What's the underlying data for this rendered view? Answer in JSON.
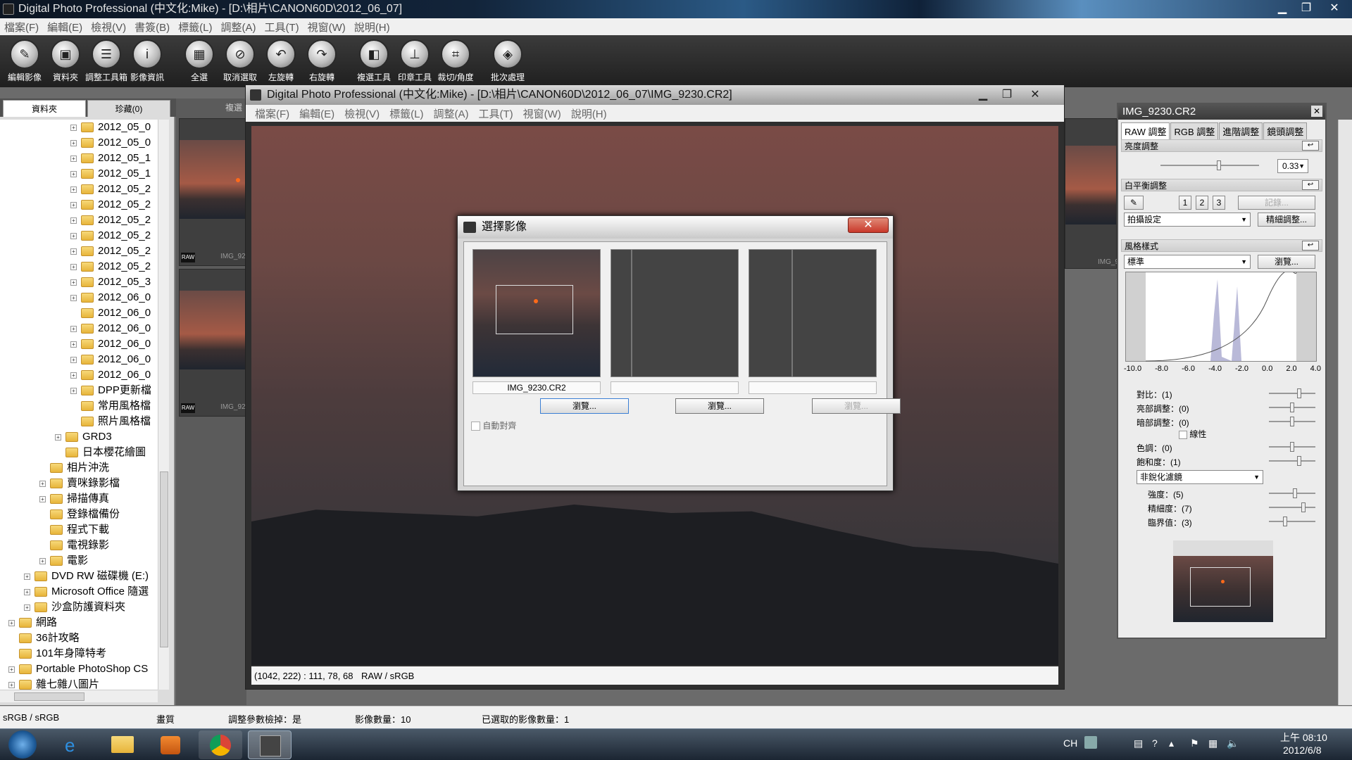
{
  "main_window": {
    "title": "Digital Photo Professional (中文化:Mike) - [D:\\相片\\CANON60D\\2012_06_07]",
    "menu": [
      "檔案(F)",
      "編輯(E)",
      "檢視(V)",
      "書簽(B)",
      "標籤(L)",
      "調整(A)",
      "工具(T)",
      "視窗(W)",
      "說明(H)"
    ]
  },
  "toolbar": {
    "buttons": [
      {
        "label": "編輯影像",
        "icon": "edit-image-icon"
      },
      {
        "label": "資料夾",
        "icon": "folder-icon"
      },
      {
        "label": "調整工具箱",
        "icon": "toolbox-icon"
      },
      {
        "label": "影像資訊",
        "icon": "info-icon"
      },
      {
        "label": "全選",
        "icon": "select-all-icon"
      },
      {
        "label": "取消選取",
        "icon": "deselect-icon"
      },
      {
        "label": "左旋轉",
        "icon": "rotate-left-icon"
      },
      {
        "label": "右旋轉",
        "icon": "rotate-right-icon"
      },
      {
        "label": "複選工具",
        "icon": "compare-tool-icon"
      },
      {
        "label": "印章工具",
        "icon": "stamp-tool-icon"
      },
      {
        "label": "裁切/角度",
        "icon": "crop-icon"
      },
      {
        "label": "批次處理",
        "icon": "batch-icon"
      }
    ]
  },
  "left_panel": {
    "tabs": [
      "資料夾",
      "珍藏(0)"
    ],
    "tree": [
      {
        "label": "2012_05_0",
        "expand": "+",
        "indent": 3
      },
      {
        "label": "2012_05_0",
        "expand": "+",
        "indent": 3
      },
      {
        "label": "2012_05_1",
        "expand": "+",
        "indent": 3
      },
      {
        "label": "2012_05_1",
        "expand": "+",
        "indent": 3
      },
      {
        "label": "2012_05_2",
        "expand": "+",
        "indent": 3
      },
      {
        "label": "2012_05_2",
        "expand": "+",
        "indent": 3
      },
      {
        "label": "2012_05_2",
        "expand": "+",
        "indent": 3
      },
      {
        "label": "2012_05_2",
        "expand": "+",
        "indent": 3
      },
      {
        "label": "2012_05_2",
        "expand": "+",
        "indent": 3
      },
      {
        "label": "2012_05_2",
        "expand": "+",
        "indent": 3
      },
      {
        "label": "2012_05_3",
        "expand": "+",
        "indent": 3
      },
      {
        "label": "2012_06_0",
        "expand": "+",
        "indent": 3
      },
      {
        "label": "2012_06_0",
        "expand": "",
        "indent": 3
      },
      {
        "label": "2012_06_0",
        "expand": "+",
        "indent": 3
      },
      {
        "label": "2012_06_0",
        "expand": "+",
        "indent": 3
      },
      {
        "label": "2012_06_0",
        "expand": "+",
        "indent": 3
      },
      {
        "label": "2012_06_0",
        "expand": "+",
        "indent": 3
      },
      {
        "label": "DPP更新檔",
        "expand": "+",
        "indent": 3
      },
      {
        "label": "常用風格檔",
        "expand": "",
        "indent": 3
      },
      {
        "label": "照片風格檔",
        "expand": "",
        "indent": 3
      },
      {
        "label": "GRD3",
        "expand": "+",
        "indent": 2
      },
      {
        "label": "日本櫻花繪圖",
        "expand": "",
        "indent": 2
      },
      {
        "label": "相片沖洗",
        "expand": "",
        "indent": 1
      },
      {
        "label": "賣咪錄影檔",
        "expand": "+",
        "indent": 1
      },
      {
        "label": "掃描傳真",
        "expand": "+",
        "indent": 1
      },
      {
        "label": "登錄檔備份",
        "expand": "",
        "indent": 1
      },
      {
        "label": "程式下載",
        "expand": "",
        "indent": 1
      },
      {
        "label": "電視錄影",
        "expand": "",
        "indent": 1
      },
      {
        "label": "電影",
        "expand": "+",
        "indent": 1
      },
      {
        "label": "DVD RW 磁碟機 (E:)",
        "expand": "+",
        "indent": 0
      },
      {
        "label": "Microsoft Office 隨選",
        "expand": "+",
        "indent": 0
      },
      {
        "label": "沙盒防護資料夾",
        "expand": "+",
        "indent": 0
      },
      {
        "label": "網路",
        "expand": "+",
        "indent": -1
      },
      {
        "label": "36計攻略",
        "expand": "",
        "indent": -1
      },
      {
        "label": "101年身障特考",
        "expand": "",
        "indent": -1
      },
      {
        "label": "Portable PhotoShop CS",
        "expand": "+",
        "indent": -1
      },
      {
        "label": "雜七雜八圖片",
        "expand": "+",
        "indent": -1
      }
    ]
  },
  "thumbnails": {
    "tab_label": "複選",
    "items": [
      {
        "caption": "IMG_92"
      },
      {
        "caption": "IMG_92"
      }
    ],
    "right_items": [
      {
        "caption": "IMG_92"
      }
    ]
  },
  "status_bar": {
    "color_space": "sRGB / sRGB",
    "quality": "畫質",
    "adjusted": "調整參數檢掉：是",
    "image_count": "影像數量：10",
    "selected_count": "已選取的影像數量：1"
  },
  "editor": {
    "title": "Digital Photo Professional (中文化:Mike) - [D:\\相片\\CANON60D\\2012_06_07\\IMG_9230.CR2]",
    "menu": [
      "檔案(F)",
      "編輯(E)",
      "檢視(V)",
      "標籤(L)",
      "調整(A)",
      "工具(T)",
      "視窗(W)",
      "說明(H)"
    ],
    "status_coords": "(1042, 222) : 111, 78, 68",
    "status_profile": "RAW / sRGB"
  },
  "dialog": {
    "title": "選擇影像",
    "slots": [
      {
        "caption": "IMG_9230.CR2",
        "browse": "瀏覽...",
        "enabled": true
      },
      {
        "caption": "",
        "browse": "瀏覽...",
        "enabled": true
      },
      {
        "caption": "",
        "browse": "瀏覽...",
        "enabled": false
      }
    ],
    "auto_align": "自動對齊"
  },
  "tool_palette": {
    "title": "IMG_9230.CR2",
    "tabs": [
      "RAW 調整",
      "RGB 調整",
      "進階調整",
      "鏡頭調整"
    ],
    "brightness": {
      "title": "亮度調整",
      "value": "0.33"
    },
    "white_balance": {
      "title": "白平衡調整",
      "btns": [
        "1",
        "2",
        "3"
      ],
      "record": "記錄...",
      "preset": "拍攝設定",
      "fine": "精細調整..."
    },
    "picture_style": {
      "title": "風格樣式",
      "preset": "標準",
      "browse": "瀏覽..."
    },
    "histogram_ticks": [
      "-10.0",
      "-8.0",
      "-6.0",
      "-4.0",
      "-2.0",
      "0.0",
      "2.0",
      "4.0"
    ],
    "params": [
      {
        "label": "對比：(1)"
      },
      {
        "label": "亮部調整：(0)"
      },
      {
        "label": "暗部調整：(0)"
      },
      {
        "label": "色調：(0)"
      },
      {
        "label": "飽和度：(1)"
      }
    ],
    "linear": "線性",
    "sharpness_mode": "非銳化濾鏡",
    "sharp_params": [
      {
        "label": "強度：(5)"
      },
      {
        "label": "精細度：(7)"
      },
      {
        "label": "臨界值：(3)"
      }
    ]
  },
  "taskbar": {
    "lang": "CH",
    "time": "上午 08:10",
    "date": "2012/6/8"
  }
}
